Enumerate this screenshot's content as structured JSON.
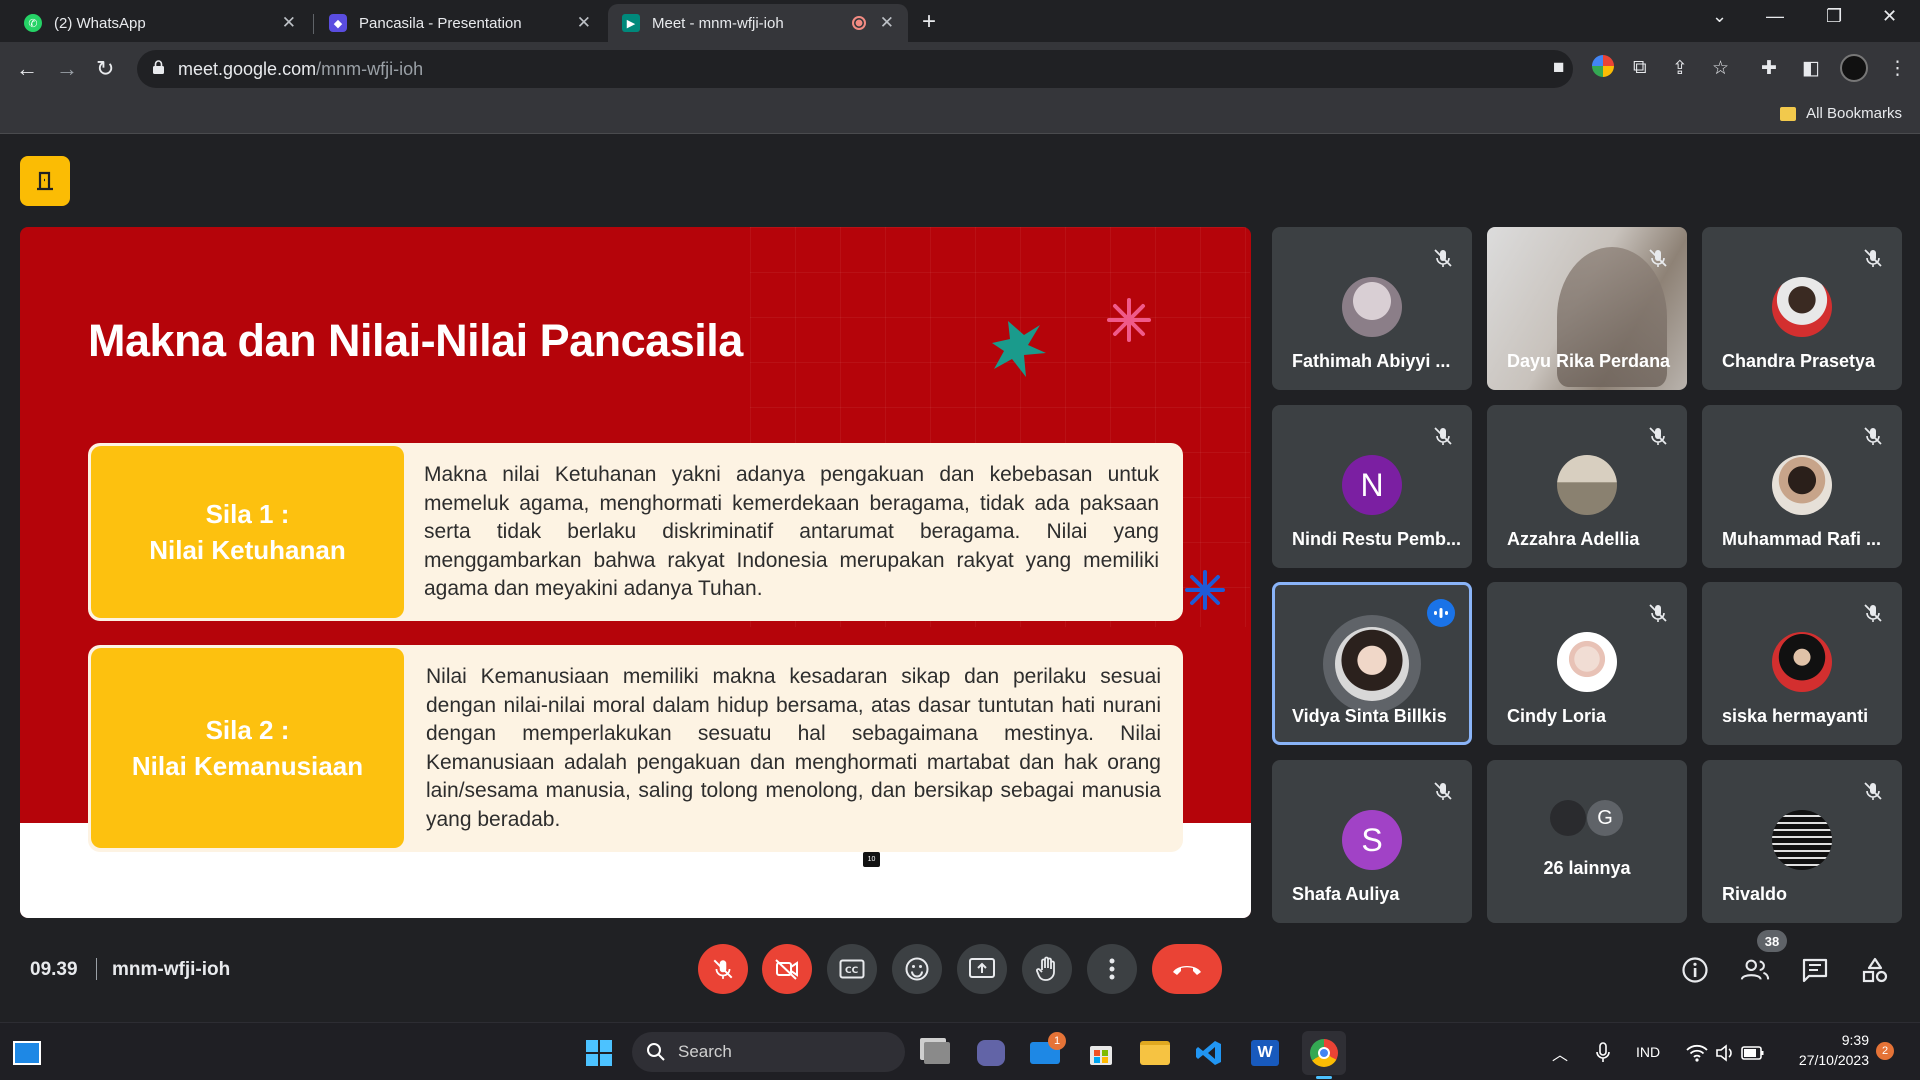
{
  "tabs": [
    {
      "title": "(2) WhatsApp"
    },
    {
      "title": "Pancasila - Presentation"
    },
    {
      "title": "Meet - mnm-wfji-ioh"
    }
  ],
  "address": {
    "host": "meet.google.com",
    "path": "/mnm-wfji-ioh"
  },
  "bookmarks_label": "All Bookmarks",
  "slide": {
    "title": "Makna dan Nilai-Nilai Pancasila",
    "cards": [
      {
        "label_line1": "Sila 1 :",
        "label_line2": "Nilai Ketuhanan",
        "text": "Makna nilai Ketuhanan yakni adanya pengakuan dan kebebasan untuk memeluk agama, menghormati kemerdekaan beragama, tidak ada paksaan serta tidak berlaku diskriminatif antarumat beragama. Nilai yang menggambarkan bahwa rakyat Indonesia merupakan rakyat yang memiliki agama dan meyakini adanya Tuhan."
      },
      {
        "label_line1": "Sila 2 :",
        "label_line2": "Nilai Kemanusiaan",
        "text": "Nilai Kemanusiaan memiliki makna kesadaran sikap dan perilaku sesuai dengan nilai-nilai moral dalam hidup bersama, atas dasar tuntutan hati nurani dengan memperlakukan sesuatu hal sebagaimana mestinya. Nilai Kemanusiaan adalah pengakuan dan menghormati martabat dan hak orang lain/sesama manusia, saling tolong menolong, dan bersikap sebagai manusia yang beradab."
      }
    ],
    "page_number": "10"
  },
  "participants": [
    {
      "name": "Fathimah Abiyyi ...",
      "muted": true
    },
    {
      "name": "Dayu Rika Perdana",
      "muted": true
    },
    {
      "name": "Chandra Prasetya",
      "muted": true
    },
    {
      "name": "Nindi Restu Pemb...",
      "muted": true,
      "initial": "N",
      "color": "#7b1fa2"
    },
    {
      "name": "Azzahra Adellia",
      "muted": true
    },
    {
      "name": "Muhammad Rafi ...",
      "muted": true
    },
    {
      "name": "Vidya Sinta Billkis",
      "muted": false,
      "speaking": true
    },
    {
      "name": "Cindy Loria",
      "muted": true
    },
    {
      "name": "siska hermayanti",
      "muted": true
    },
    {
      "name": "Shafa Auliya",
      "muted": true,
      "initial": "S",
      "color": "#a142c6"
    },
    {
      "name": "26 lainnya",
      "others_initial": "G"
    },
    {
      "name": "Rivaldo",
      "muted": true
    }
  ],
  "meeting": {
    "time": "09.39",
    "code": "mnm-wfji-ioh",
    "people_count": "38"
  },
  "taskbar": {
    "search_label": "Search",
    "mail_badge": "1",
    "language": "IND",
    "time": "9:39",
    "date": "27/10/2023",
    "notification_count": "2"
  },
  "colors": {
    "slide_red": "#b5040a",
    "label_yellow": "#fdc10f",
    "end_call_red": "#ea4335",
    "speaking_blue": "#8ab4f8"
  }
}
